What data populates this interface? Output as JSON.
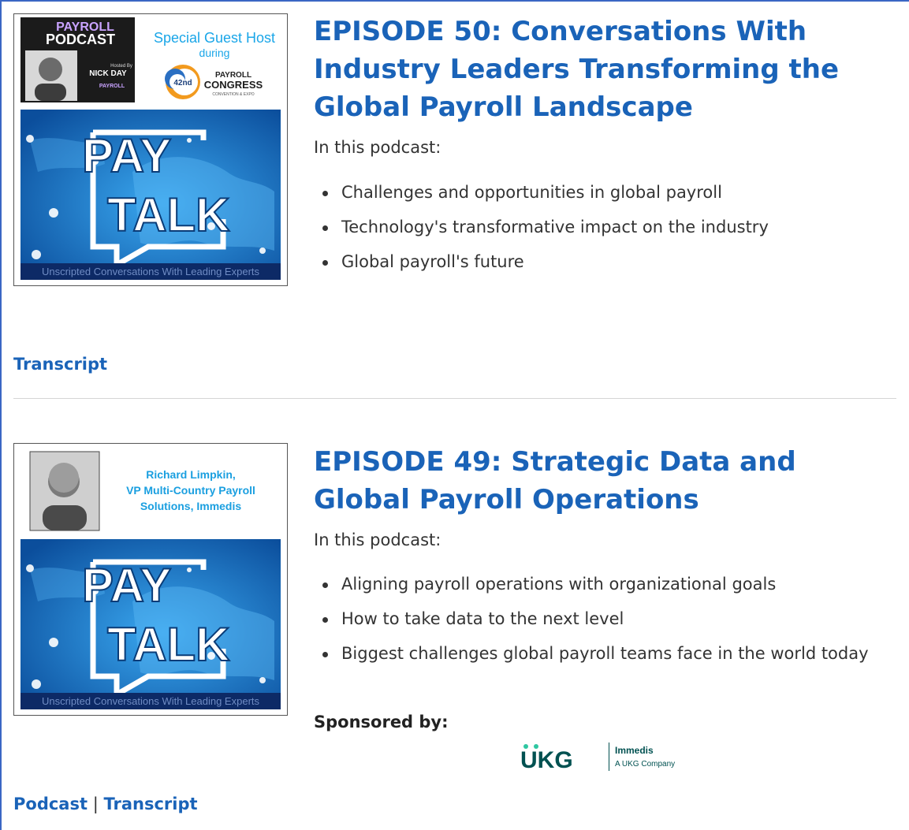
{
  "episodes": [
    {
      "title": "EPISODE 50: Conversations With Industry Leaders Transforming the Global Payroll Landscape",
      "intro": "In this podcast:",
      "bullets": [
        "Challenges and opportunities in global payroll",
        "Technology's transformative impact on the industry",
        "Global payroll's future"
      ],
      "transcript_link": "Transcript",
      "thumbnail": {
        "badge_line1": "PAYROLL",
        "badge_line2": "PODCAST",
        "hosted_by": "Hosted By",
        "host_name": "NICK DAY",
        "badge_org": "PAYROLL",
        "guest_host_title": "Special Guest Host",
        "guest_host_during": "during",
        "congress_number": "42nd",
        "congress_line1": "PAYROLL",
        "congress_line2": "CONGRESS",
        "congress_line3": "CONVENTION & EXPO",
        "logo_line1": "PAY",
        "logo_line2": "TALK",
        "tagline": "Unscripted Conversations With Leading Experts"
      }
    },
    {
      "title": "EPISODE 49: Strategic Data and Global Payroll Operations",
      "intro": "In this podcast:",
      "bullets": [
        "Aligning payroll operations with organizational goals",
        "How to take data to the next level",
        "Biggest challenges global payroll teams face in the world today"
      ],
      "sponsored_label": "Sponsored by:",
      "sponsor_logo": {
        "main": "UKG",
        "name": "Immedis",
        "sub": "A UKG Company",
        "color": "#005151"
      },
      "podcast_link": "Podcast",
      "separator": "|",
      "transcript_link": "Transcript",
      "thumbnail": {
        "guest_line1": "Richard Limpkin,",
        "guest_line2": "VP Multi-Country Payroll",
        "guest_line3": "Solutions, Immedis",
        "logo_line1": "PAY",
        "logo_line2": "TALK",
        "tagline": "Unscripted Conversations With Leading Experts"
      }
    }
  ],
  "colors": {
    "link": "#1a63b8",
    "title": "#1a63b8",
    "map_blue": "#1a7fd4",
    "guest_text": "#1a9fe0"
  }
}
